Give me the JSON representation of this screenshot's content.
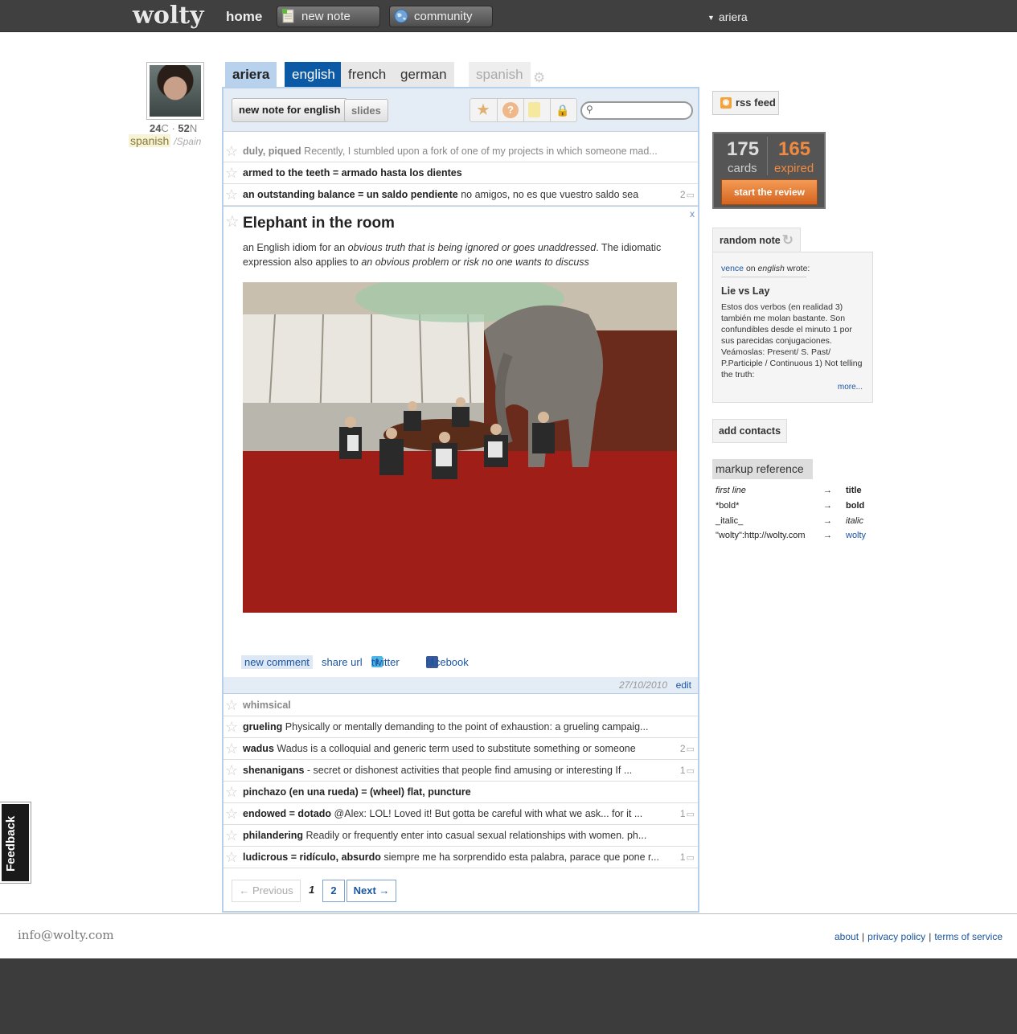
{
  "topbar": {
    "logo": "wolty",
    "home": "home",
    "new_note": "new note",
    "community": "community",
    "user": "ariera"
  },
  "profile": {
    "cards_count": "24",
    "cards_unit": "C",
    "notes_count": "52",
    "notes_unit": "N",
    "language": "spanish",
    "country": "/Spain"
  },
  "tabs": {
    "user": "ariera",
    "langs": [
      "english",
      "french",
      "german"
    ],
    "inactive": "spanish"
  },
  "toolbar": {
    "new_note_for": "new note for english",
    "slides": "slides",
    "search_placeholder": ""
  },
  "notes_top": [
    {
      "title": "duly, piqued",
      "text": " Recently, I stumbled upon a fork of one of my projects in which someone mad...",
      "muted": true
    },
    {
      "title": "armed to the teeth = armado hasta los dientes",
      "text": ""
    },
    {
      "title": "an outstanding balance = un saldo pendiente",
      "text": " no amigos, no es que vuestro saldo sea",
      "count": "2"
    }
  ],
  "expanded_note": {
    "close": "x",
    "title": "Elephant in the room",
    "body_plain_1": "an English idiom for an ",
    "body_italic_1": "obvious truth that is being ignored or goes unaddressed",
    "body_plain_2": ". The idiomatic expression also applies to ",
    "body_italic_2": "an obvious problem or risk no one wants to discuss",
    "new_comment": "new comment",
    "share_url": "share url",
    "twitter": "twitter",
    "facebook": "facebook",
    "date": "27/10/2010",
    "edit": "edit"
  },
  "notes_bottom": [
    {
      "title": "whimsical",
      "text": "",
      "muted": true
    },
    {
      "title": "grueling",
      "text": " Physically or mentally demanding to the point of exhaustion: a grueling campaig..."
    },
    {
      "title": "wadus",
      "text": " Wadus is a colloquial and generic term used to substitute something or someone",
      "count": "2"
    },
    {
      "title": "shenanigans",
      "text": " - secret or dishonest activities that people find amusing or interesting If ...",
      "count": "1"
    },
    {
      "title": "pinchazo (en una rueda) = (wheel) flat, puncture",
      "text": ""
    },
    {
      "title": "endowed = dotado",
      "text": " @Alex: LOL! Loved it! But gotta be careful with what we ask... for it ...",
      "count": "1"
    },
    {
      "title": "philandering",
      "text": " Readily or frequently enter into casual sexual relationships with women. ph..."
    },
    {
      "title": "ludicrous = ridículo, absurdo",
      "text": " siempre me ha sorprendido esta palabra, paracе que pone r...",
      "count": "1"
    }
  ],
  "pager": {
    "prev": "← Previous",
    "current": "1",
    "page2": "2",
    "next": "Next →"
  },
  "sidebar": {
    "rss": "rss feed",
    "cards_num": "175",
    "cards_label": "cards",
    "expired_num": "165",
    "expired_label": "expired",
    "review": "start the review",
    "random_note": "random note",
    "rn_user": "vence",
    "rn_on": " on ",
    "rn_lang": "english",
    "rn_wrote": " wrote:",
    "rn_title": "Lie vs Lay",
    "rn_text": "Estos dos verbos (en realidad 3) también me molan bastante. Son confundibles desde el minuto 1 por sus parecidas conjugaciones. Veámoslas: Present/ S. Past/ P.Participle / Continuous 1) Not telling the truth:",
    "rn_more": "more...",
    "add_contacts": "add contacts",
    "markup_title": "markup reference",
    "markup": [
      {
        "left": "first line",
        "arrow": "→",
        "right": "title"
      },
      {
        "left": "*bold*",
        "arrow": "→",
        "right": "bold"
      },
      {
        "left": "_italic_",
        "arrow": "→",
        "right": "italic"
      },
      {
        "left": "\"wolty\":http://wolty.com",
        "arrow": "→",
        "right": "wolty"
      }
    ]
  },
  "feedback": "Feedback",
  "footer": {
    "email": "info@wolty.com",
    "about": "about",
    "privacy": "privacy policy",
    "terms": "terms of service"
  },
  "colors": {
    "accent": "#0c5aa6",
    "expired": "#f08a40",
    "topbar": "#404040"
  }
}
